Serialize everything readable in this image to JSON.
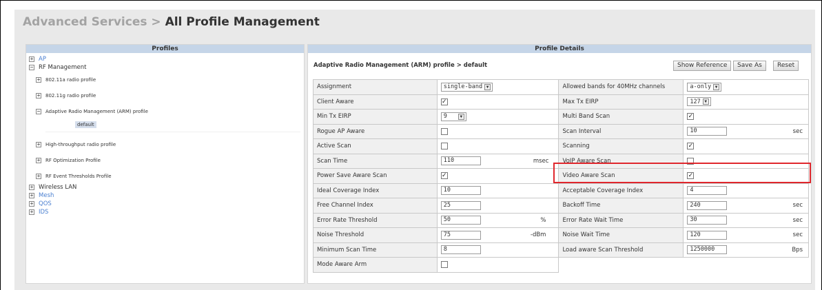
{
  "breadcrumb": {
    "parent": "Advanced Services",
    "separator": ">",
    "current": "All Profile Management"
  },
  "left_pane": {
    "header": "Profiles",
    "tree": {
      "ap": "AP",
      "rf_management": "RF Management",
      "radio_80211a": "802.11a radio profile",
      "radio_80211g": "802.11g radio profile",
      "arm_profile": "Adaptive Radio Management (ARM) profile",
      "arm_default": "default",
      "ht_radio": "High-throughput radio profile",
      "rf_optimization": "RF Optimization Profile",
      "rf_event": "RF Event Thresholds Profile",
      "wireless_lan": "Wireless LAN",
      "mesh": "Mesh",
      "qos": "QOS",
      "ids": "IDS"
    }
  },
  "right_pane": {
    "header": "Profile Details",
    "title": "Adaptive Radio Management (ARM) profile > default",
    "buttons": {
      "show_reference": "Show Reference",
      "save_as": "Save As",
      "reset": "Reset"
    },
    "fields": {
      "assignment": {
        "label": "Assignment",
        "value": "single-band"
      },
      "client_aware": {
        "label": "Client Aware",
        "checked": true
      },
      "min_tx_eirp": {
        "label": "Min Tx EIRP",
        "value": "9"
      },
      "rogue_ap_aware": {
        "label": "Rogue AP Aware",
        "checked": false
      },
      "active_scan": {
        "label": "Active Scan",
        "checked": false
      },
      "scan_time": {
        "label": "Scan Time",
        "value": "110",
        "unit": "msec"
      },
      "power_save_aware_scan": {
        "label": "Power Save Aware Scan",
        "checked": true
      },
      "ideal_coverage_index": {
        "label": "Ideal Coverage Index",
        "value": "10"
      },
      "free_channel_index": {
        "label": "Free Channel Index",
        "value": "25"
      },
      "error_rate_threshold": {
        "label": "Error Rate Threshold",
        "value": "50",
        "unit": "%"
      },
      "noise_threshold": {
        "label": "Noise Threshold",
        "value": "75",
        "unit": "-dBm"
      },
      "minimum_scan_time": {
        "label": "Minimum Scan Time",
        "value": "8"
      },
      "mode_aware_arm": {
        "label": "Mode Aware Arm",
        "checked": false
      },
      "allowed_bands_40mhz": {
        "label": "Allowed bands for 40MHz channels",
        "value": "a-only"
      },
      "max_tx_eirp": {
        "label": "Max Tx EIRP",
        "value": "127"
      },
      "multi_band_scan": {
        "label": "Multi Band Scan",
        "checked": true
      },
      "scan_interval": {
        "label": "Scan Interval",
        "value": "10",
        "unit": "sec"
      },
      "scanning": {
        "label": "Scanning",
        "checked": true
      },
      "voip_aware_scan": {
        "label": "VoIP Aware Scan",
        "checked": false
      },
      "video_aware_scan": {
        "label": "Video Aware Scan",
        "checked": true
      },
      "acceptable_coverage_index": {
        "label": "Acceptable Coverage Index",
        "value": "4"
      },
      "backoff_time": {
        "label": "Backoff Time",
        "value": "240",
        "unit": "sec"
      },
      "error_rate_wait_time": {
        "label": "Error Rate Wait Time",
        "value": "30",
        "unit": "sec"
      },
      "noise_wait_time": {
        "label": "Noise Wait Time",
        "value": "120",
        "unit": "sec"
      },
      "load_aware_scan_threshold": {
        "label": "Load aware Scan Threshold",
        "value": "1250000",
        "unit": "Bps"
      }
    },
    "checkmark_glyph": "✓",
    "dropdown_glyph": "▼"
  },
  "colors": {
    "highlight": "#e0262c",
    "pane_header": "#c5d5e8",
    "link": "#4a7fd0"
  }
}
